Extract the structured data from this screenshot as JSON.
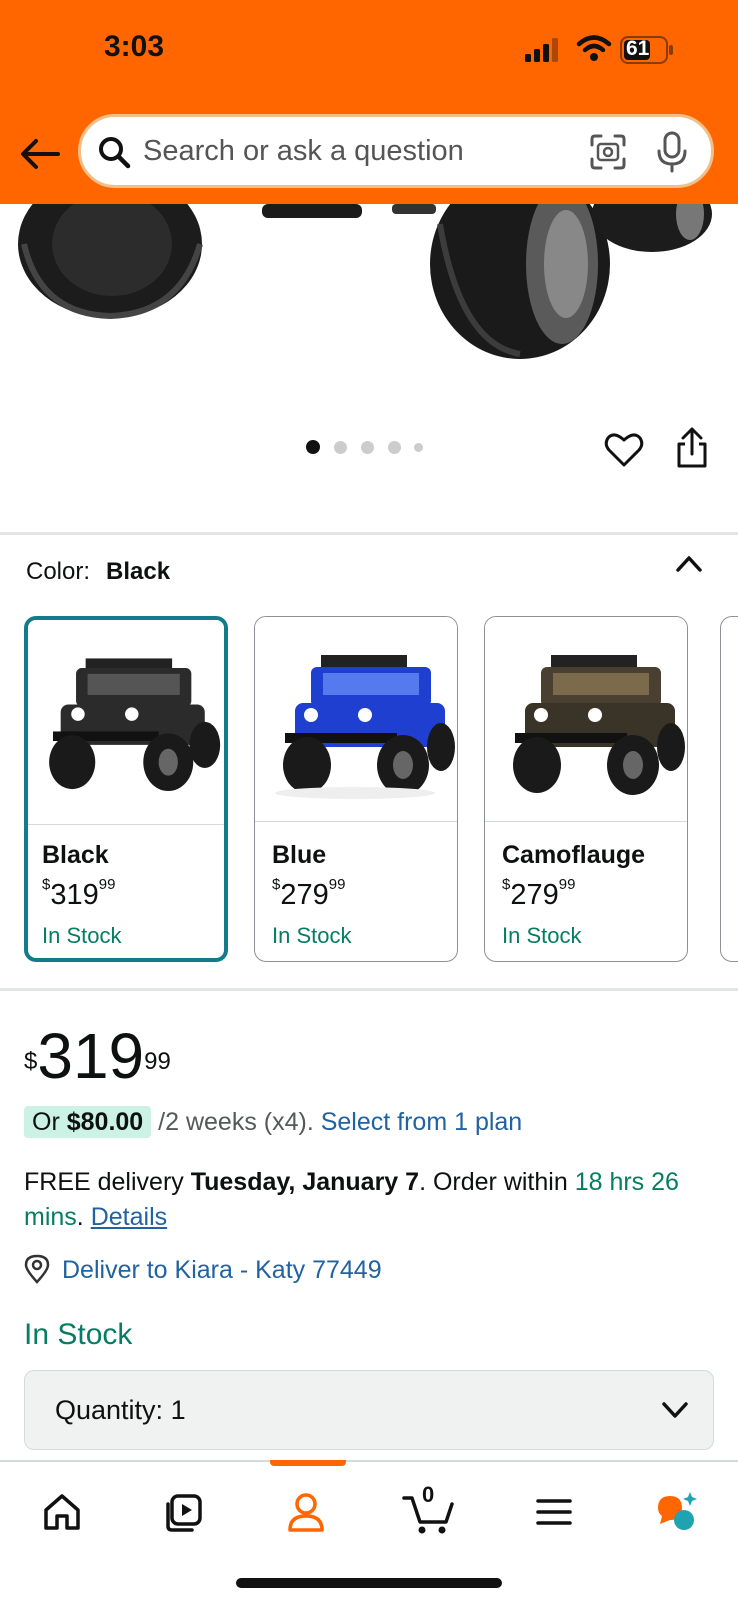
{
  "status_bar": {
    "time": "3:03",
    "battery": "61"
  },
  "search": {
    "placeholder": "Search or ask a question"
  },
  "gallery": {
    "dots": 5,
    "active_dot": 0
  },
  "color_selector": {
    "label": "Color:",
    "selected": "Black",
    "variants": [
      {
        "name": "Black",
        "price_currency": "$",
        "price_whole": "319",
        "price_fraction": "99",
        "stock": "In Stock",
        "body_color": "#2b2b2b",
        "selected": true
      },
      {
        "name": "Blue",
        "price_currency": "$",
        "price_whole": "279",
        "price_fraction": "99",
        "stock": "In Stock",
        "body_color": "#1f3fd1",
        "selected": false
      },
      {
        "name": "Camoflauge",
        "price_currency": "$",
        "price_whole": "279",
        "price_fraction": "99",
        "stock": "In Stock",
        "body_color": "#4a4032",
        "selected": false
      }
    ]
  },
  "price": {
    "currency": "$",
    "whole": "319",
    "fraction": "99"
  },
  "payment_plan": {
    "prefix": "Or",
    "amount": "$80.00",
    "terms": "/2 weeks (x4).",
    "link": "Select from 1 plan"
  },
  "delivery": {
    "prefix": "FREE delivery",
    "date": "Tuesday, January 7",
    "middle": ". Order within",
    "countdown": "18 hrs 26 mins",
    "period": ".",
    "details_link": "Details"
  },
  "deliver_to": "Deliver to Kiara - Katy 77449",
  "stock_status": "In Stock",
  "quantity": {
    "label": "Quantity:",
    "value": "1"
  },
  "cart_count": "0",
  "colors": {
    "brand_orange": "#ff6600",
    "stock_green": "#067d62",
    "link_blue": "#2162a1",
    "selected_border": "#127c8a"
  }
}
